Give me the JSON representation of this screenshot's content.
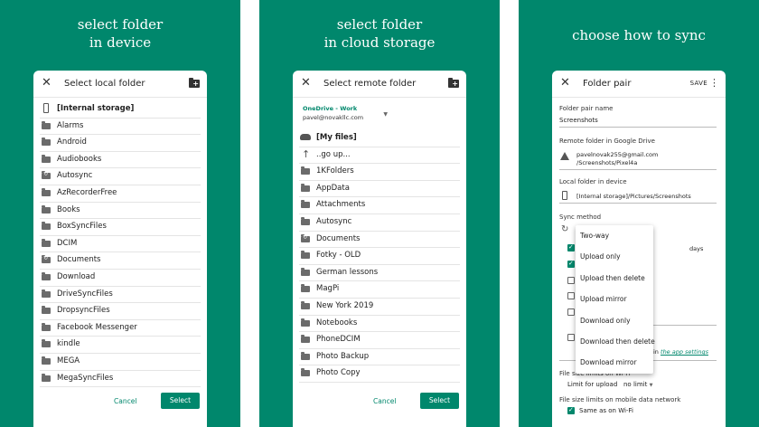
{
  "panels": [
    {
      "headline": [
        "select folder",
        "in device"
      ],
      "dialog": {
        "title": "Select local folder",
        "items": [
          {
            "label": "[Internal storage]",
            "kind": "phone"
          },
          {
            "label": "Alarms",
            "kind": "folder"
          },
          {
            "label": "Android",
            "kind": "folder"
          },
          {
            "label": "Audiobooks",
            "kind": "folder"
          },
          {
            "label": "Autosync",
            "kind": "synced-folder"
          },
          {
            "label": "AzRecorderFree",
            "kind": "folder"
          },
          {
            "label": "Books",
            "kind": "folder"
          },
          {
            "label": "BoxSyncFiles",
            "kind": "folder"
          },
          {
            "label": "DCIM",
            "kind": "folder"
          },
          {
            "label": "Documents",
            "kind": "synced-folder"
          },
          {
            "label": "Download",
            "kind": "folder"
          },
          {
            "label": "DriveSyncFiles",
            "kind": "folder"
          },
          {
            "label": "DropsyncFiles",
            "kind": "folder"
          },
          {
            "label": "Facebook Messenger",
            "kind": "folder"
          },
          {
            "label": "kindle",
            "kind": "folder"
          },
          {
            "label": "MEGA",
            "kind": "folder"
          },
          {
            "label": "MegaSyncFiles",
            "kind": "folder"
          }
        ],
        "cancel": "Cancel",
        "select": "Select"
      }
    },
    {
      "headline": [
        "select folder",
        "in cloud storage"
      ],
      "dialog": {
        "title": "Select remote folder",
        "account_name": "OneDrive - Work",
        "account_email": "pavel@novakllc.com",
        "items": [
          {
            "label": "[My files]",
            "kind": "cloud"
          },
          {
            "label": "..go up...",
            "kind": "up"
          },
          {
            "label": "1KFolders",
            "kind": "folder"
          },
          {
            "label": "AppData",
            "kind": "folder"
          },
          {
            "label": "Attachments",
            "kind": "folder"
          },
          {
            "label": "Autosync",
            "kind": "folder"
          },
          {
            "label": "Documents",
            "kind": "synced-folder"
          },
          {
            "label": "Fotky - OLD",
            "kind": "folder"
          },
          {
            "label": "German lessons",
            "kind": "folder"
          },
          {
            "label": "MagPi",
            "kind": "folder"
          },
          {
            "label": "New York 2019",
            "kind": "folder"
          },
          {
            "label": "Notebooks",
            "kind": "folder"
          },
          {
            "label": "PhoneDCIM",
            "kind": "folder"
          },
          {
            "label": "Photo Backup",
            "kind": "folder"
          },
          {
            "label": "Photo Copy",
            "kind": "folder"
          }
        ],
        "cancel": "Cancel",
        "select": "Select"
      }
    },
    {
      "headline": [
        "choose how to sync"
      ],
      "dialog": {
        "title": "Folder pair",
        "save": "SAVE",
        "pair_name_label": "Folder pair name",
        "pair_name_value": "Screenshots",
        "remote_label": "Remote folder in Google Drive",
        "remote_line1": "pavelnovak255@gmail.com",
        "remote_line2": "/Screenshots/Pixel4a",
        "local_label": "Local folder in device",
        "local_value": "[Internal storage]/Pictures/Screenshots",
        "method_label": "Sync method",
        "method_options": [
          "Two-way",
          "Upload only",
          "Upload then delete",
          "Upload mirror",
          "Download only",
          "Download then delete",
          "Download mirror"
        ],
        "days": "days",
        "settings_suffix": "in",
        "settings_link": "the app settings",
        "wifi_limits_label": "File size limits on Wi-Fi",
        "limit_upload_label": "Limit for upload",
        "limit_upload_value": "no limit",
        "mobile_limits_label": "File size limits on mobile data network",
        "same_as_wifi": "Same as on Wi-Fi"
      }
    }
  ]
}
